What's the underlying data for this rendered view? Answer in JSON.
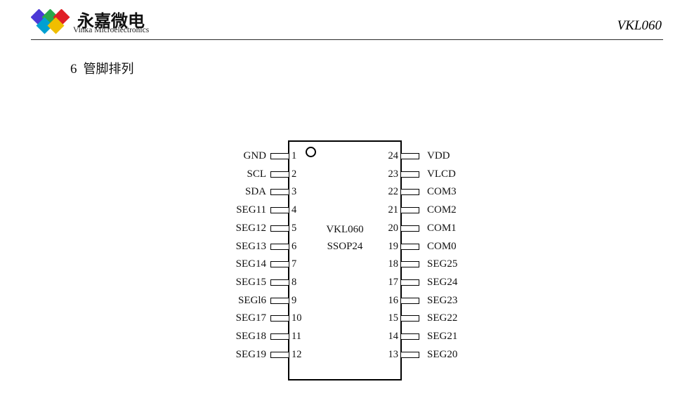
{
  "header": {
    "logo": {
      "icon_name": "vinka-diamond-logo",
      "wordmark_cn": "永嘉微电",
      "wordmark_en": "Vinka Microelectronics",
      "colors": {
        "diamond_purple": "#4B39D6",
        "diamond_green": "#2AA84A",
        "diamond_red": "#E01F26",
        "diamond_cyan": "#00A0D2",
        "diamond_yellow": "#F0BE00"
      }
    },
    "part_number": "VKL060"
  },
  "section": {
    "number": "6",
    "title": "管脚排列"
  },
  "diagram": {
    "chip_name": "VKL060",
    "package": "SSOP24",
    "pin1_indicator": "pin1-dot",
    "left_pins": [
      {
        "number": "1",
        "label": "GND"
      },
      {
        "number": "2",
        "label": "SCL"
      },
      {
        "number": "3",
        "label": "SDA"
      },
      {
        "number": "4",
        "label": "SEG11"
      },
      {
        "number": "5",
        "label": "SEG12"
      },
      {
        "number": "6",
        "label": "SEG13"
      },
      {
        "number": "7",
        "label": "SEG14"
      },
      {
        "number": "8",
        "label": "SEG15"
      },
      {
        "number": "9",
        "label": "SEGl6"
      },
      {
        "number": "10",
        "label": "SEG17"
      },
      {
        "number": "11",
        "label": "SEG18"
      },
      {
        "number": "12",
        "label": "SEG19"
      }
    ],
    "right_pins": [
      {
        "number": "24",
        "label": "VDD"
      },
      {
        "number": "23",
        "label": "VLCD"
      },
      {
        "number": "22",
        "label": "COM3"
      },
      {
        "number": "21",
        "label": "COM2"
      },
      {
        "number": "20",
        "label": "COM1"
      },
      {
        "number": "19",
        "label": "COM0"
      },
      {
        "number": "18",
        "label": "SEG25"
      },
      {
        "number": "17",
        "label": "SEG24"
      },
      {
        "number": "16",
        "label": "SEG23"
      },
      {
        "number": "15",
        "label": "SEG22"
      },
      {
        "number": "14",
        "label": "SEG21"
      },
      {
        "number": "13",
        "label": "SEG20"
      }
    ]
  }
}
